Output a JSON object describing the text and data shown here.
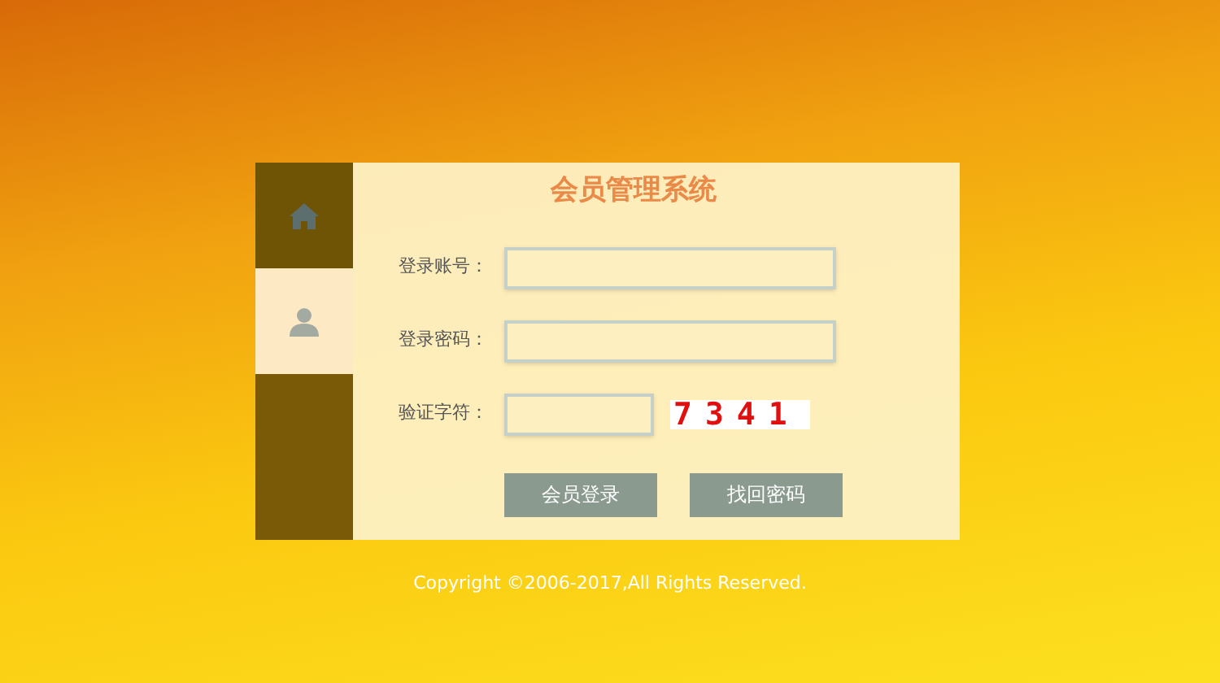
{
  "sidebar": {
    "tabs": [
      {
        "kind": "home",
        "selected": false
      },
      {
        "kind": "user",
        "selected": true
      }
    ]
  },
  "title": "会员管理系统",
  "fields": [
    {
      "label": "登录账号：",
      "kind": "text"
    },
    {
      "label": "登录密码：",
      "kind": "text"
    },
    {
      "label": "验证字符：",
      "kind": "captcha",
      "captcha": "7341"
    }
  ],
  "buttons": [
    "会员登录",
    "找回密码"
  ],
  "footer": "Copyright ©2006-2017,All Rights Reserved."
}
